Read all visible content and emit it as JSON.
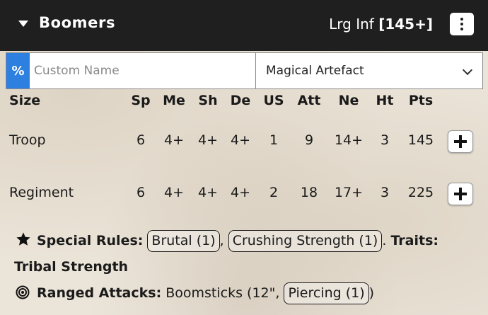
{
  "header": {
    "unit_name": "Boomers",
    "unit_type": "Lrg Inf",
    "unit_points": "[145+]"
  },
  "custom_name": {
    "prefix_symbol": "%",
    "placeholder": "Custom Name",
    "value": ""
  },
  "artefact_select": {
    "selected": "Magical Artefact"
  },
  "stats": {
    "headers": [
      "Size",
      "Sp",
      "Me",
      "Sh",
      "De",
      "US",
      "Att",
      "Ne",
      "Ht",
      "Pts"
    ],
    "rows": [
      {
        "size": "Troop",
        "sp": "6",
        "me": "4+",
        "sh": "4+",
        "de": "4+",
        "us": "1",
        "att": "9",
        "ne": "14+",
        "ht": "3",
        "pts": "145"
      },
      {
        "size": "Regiment",
        "sp": "6",
        "me": "4+",
        "sh": "4+",
        "de": "4+",
        "us": "2",
        "att": "18",
        "ne": "17+",
        "ht": "3",
        "pts": "225"
      }
    ]
  },
  "special_rules": {
    "label": "Special Rules:",
    "rules": [
      "Brutal (1)",
      "Crushing Strength (1)"
    ],
    "traits_label": "Traits: Tribal Strength"
  },
  "ranged_attacks": {
    "label": "Ranged Attacks:",
    "weapon_text": "Boomsticks (12\",",
    "weapon_rule": "Piercing (1)",
    "close_paren": ")"
  },
  "icons": {
    "collapse": "caret-down-icon",
    "menu": "kebab-menu-icon",
    "add": "plus-icon",
    "special_rules": "star-icon",
    "ranged": "target-icon",
    "dropdown": "chevron-down-icon"
  },
  "colors": {
    "header_bg": "#1f1f1f",
    "accent_blue": "#2d7fe0"
  }
}
